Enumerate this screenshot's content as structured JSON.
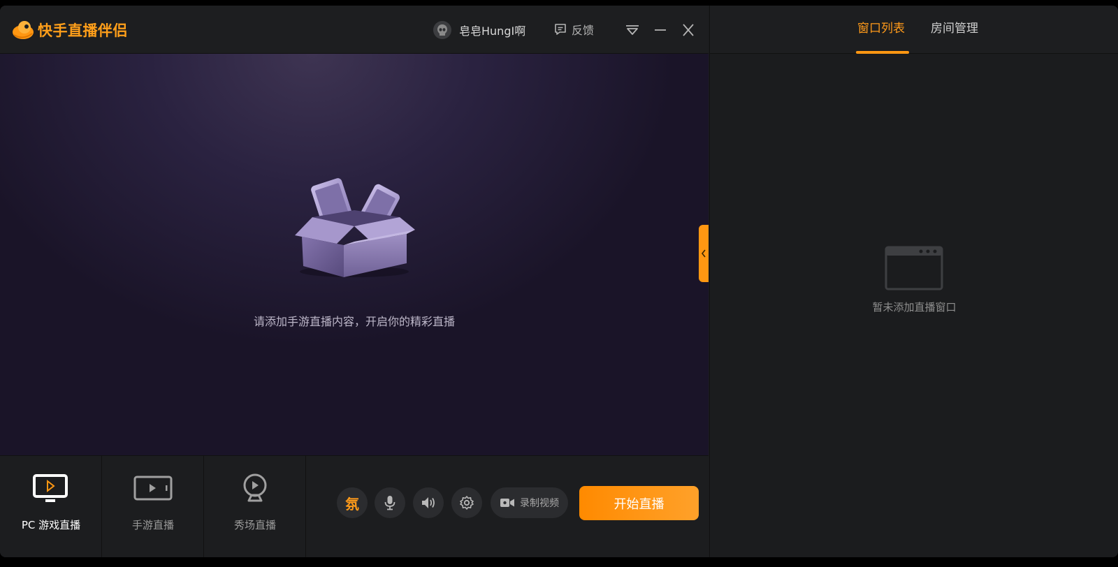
{
  "app": {
    "title": "快手直播伴侣",
    "brand_color": "#ff9712"
  },
  "titlebar": {
    "user_name": "皂皂HungI啊",
    "feedback_label": "反馈",
    "icons": [
      "avatar-icon",
      "feedback-icon",
      "dropdown-icon",
      "minimize-icon",
      "close-icon"
    ]
  },
  "stage": {
    "empty_message": "请添加手游直播内容，开启你的精彩直播"
  },
  "modes": [
    {
      "label": "PC 游戏直播",
      "icon": "monitor-play-icon",
      "active": true
    },
    {
      "label": "手游直播",
      "icon": "phone-play-icon",
      "active": false
    },
    {
      "label": "秀场直播",
      "icon": "webcam-icon",
      "active": false
    }
  ],
  "controls": {
    "ambience_glyph": "氛",
    "record_label": "录制视频",
    "start_label": "开始直播",
    "icons": [
      "ambience-icon",
      "microphone-icon",
      "speaker-icon",
      "settings-icon",
      "video-camera-icon"
    ]
  },
  "right_panel": {
    "tabs": [
      {
        "label": "窗口列表",
        "active": true
      },
      {
        "label": "房间管理",
        "active": false
      }
    ],
    "empty_message": "暂未添加直播窗口"
  }
}
